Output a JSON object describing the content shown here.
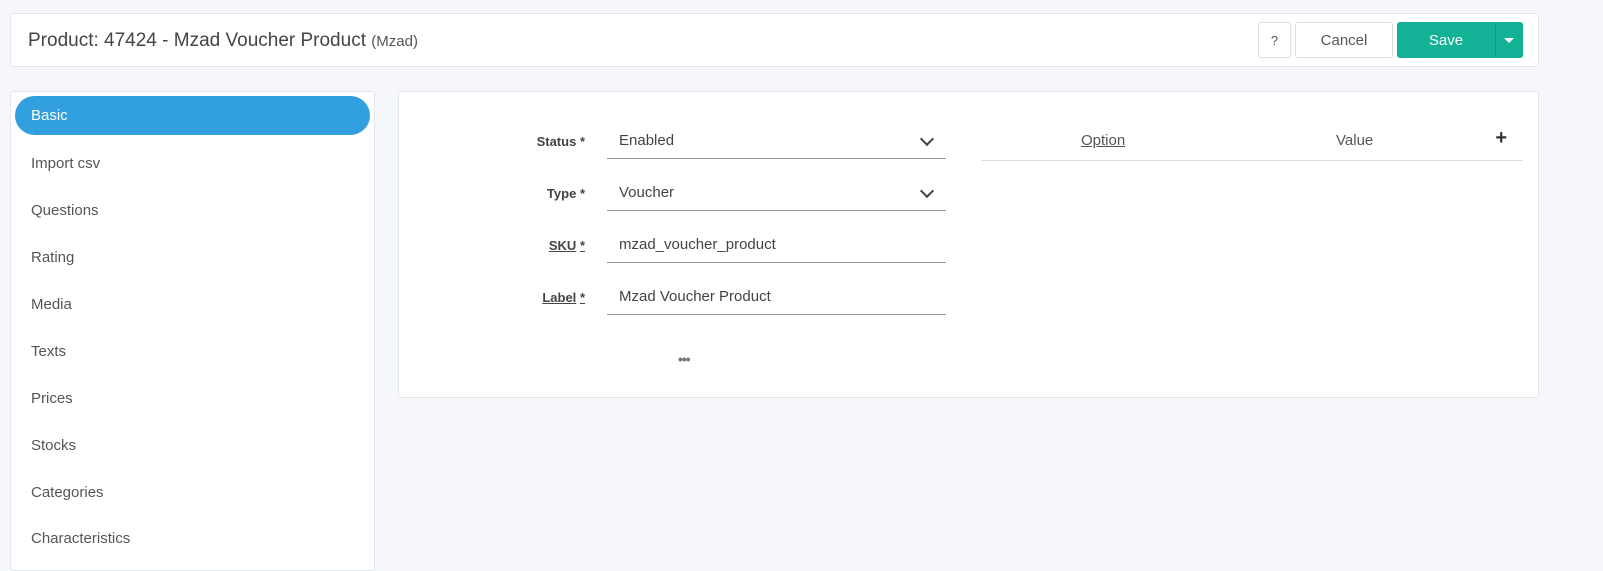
{
  "header": {
    "title": "Product: 47424 - Mzad Voucher Product",
    "subtitle": "(Mzad)",
    "help_label": "?",
    "cancel_label": "Cancel",
    "save_label": "Save"
  },
  "sidebar": {
    "items": [
      {
        "label": "Basic",
        "active": true
      },
      {
        "label": "Import csv"
      },
      {
        "label": "Questions"
      },
      {
        "label": "Rating"
      },
      {
        "label": "Media"
      },
      {
        "label": "Texts"
      },
      {
        "label": "Prices"
      },
      {
        "label": "Stocks"
      },
      {
        "label": "Categories"
      },
      {
        "label": "Characteristics"
      }
    ]
  },
  "form": {
    "status": {
      "label": "Status",
      "required": "*",
      "value": "Enabled"
    },
    "type": {
      "label": "Type",
      "required": "*",
      "value": "Voucher"
    },
    "sku": {
      "label": "SKU",
      "required": "*",
      "value": "mzad_voucher_product"
    },
    "label": {
      "label": "Label",
      "required": "*",
      "value": "Mzad Voucher Product"
    },
    "more_label": "•••"
  },
  "options_table": {
    "option_header": "Option",
    "value_header": "Value",
    "add_label": "+"
  },
  "colors": {
    "accent": "#329fdf",
    "save": "#13b195"
  }
}
